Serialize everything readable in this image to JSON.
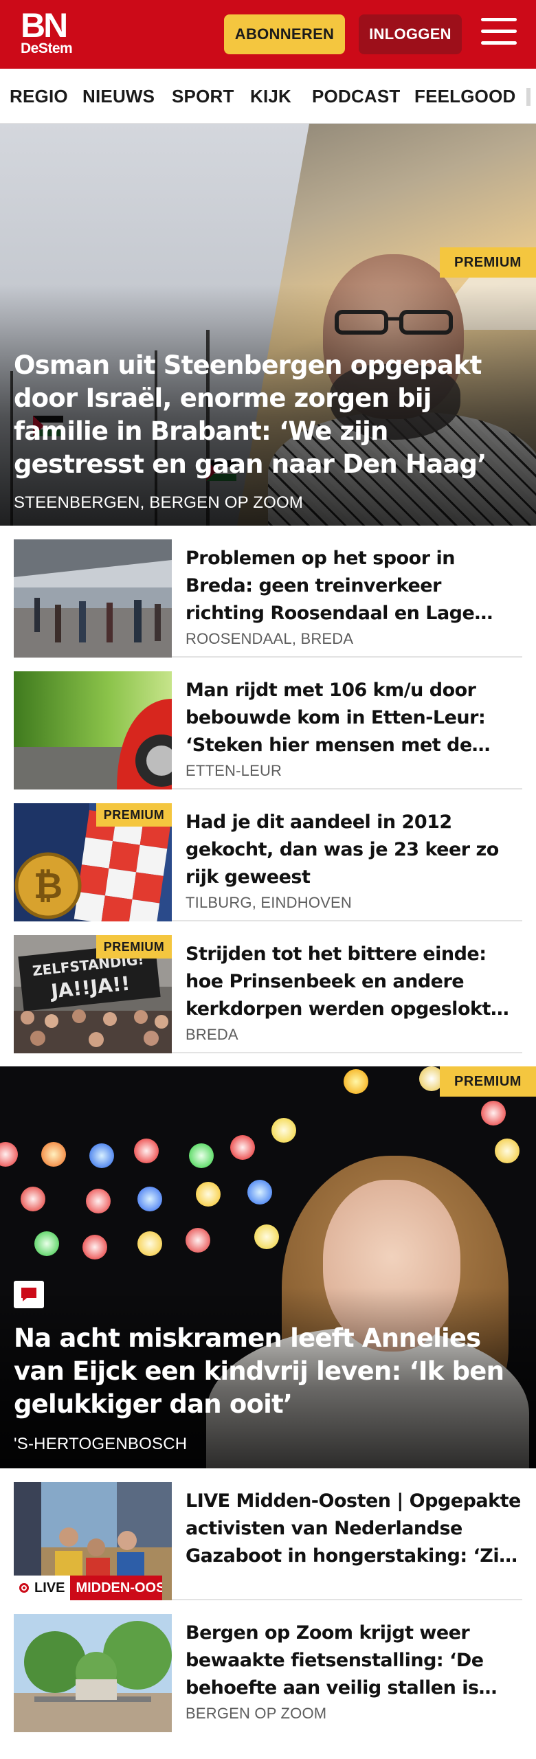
{
  "header": {
    "logo_main": "BN",
    "logo_sub": "DeStem",
    "subscribe_label": "ABONNEREN",
    "login_label": "INLOGGEN"
  },
  "nav": {
    "items": [
      "REGIO",
      "NIEUWS",
      "SPORT",
      "KIJK",
      "PODCAST",
      "FEELGOOD"
    ]
  },
  "hero1": {
    "badge": "PREMIUM",
    "title": "Osman uit Steenbergen opgepakt door Israël, enorme zorgen bij familie in Brabant: ‘We zijn gestresst en gaan naar Den Haag’",
    "location": "STEENBERGEN, BERGEN OP ZOOM"
  },
  "articles": [
    {
      "title": "Problemen op het spoor in Breda: geen treinverkeer richting Roosendaal en Lage Zwaluwe",
      "location": "ROOSENDAAL, BREDA"
    },
    {
      "title": "Man rijdt met 106 km/u door bebouwde kom in Etten-Leur: ‘Steken hier mensen met de hond over’",
      "location": "ETTEN-LEUR"
    },
    {
      "title": "Had je dit aandeel in 2012 gekocht, dan was je 23 keer zo rijk geweest",
      "location": "TILBURG, EINDHOVEN",
      "badge": "PREMIUM"
    },
    {
      "title": "Strijden tot het bittere einde: hoe Prinsenbeek en andere kerkdorpen werden opgeslokt door Breda",
      "location": "BREDA",
      "badge": "PREMIUM"
    }
  ],
  "hero2": {
    "badge": "PREMIUM",
    "title": "Na acht miskramen leeft Annelies van Eijck een kindvrij leven: ‘Ik ben gelukkiger dan ooit’",
    "location": "'S-HERTOGENBOSCH"
  },
  "articles2": [
    {
      "title": "LIVE Midden-Oosten | Opgepakte activisten van Nederlandse Gazaboot in hongerstaking: ‘Zij worden behandeld als terroristen’",
      "live_label": "LIVE",
      "live_category": "MIDDEN-OOSTEN"
    },
    {
      "title": "Bergen op Zoom krijgt weer bewaakte fietsenstalling: ‘De behoefte aan veilig stallen is groot’",
      "location": "BERGEN OP ZOOM"
    }
  ],
  "colors": {
    "brand_red": "#cc0a18",
    "premium_yellow": "#f4c63f",
    "login_dark_red": "#9d0f1a"
  },
  "icons": [
    "menu-icon",
    "comment-icon",
    "live-dot-icon"
  ]
}
